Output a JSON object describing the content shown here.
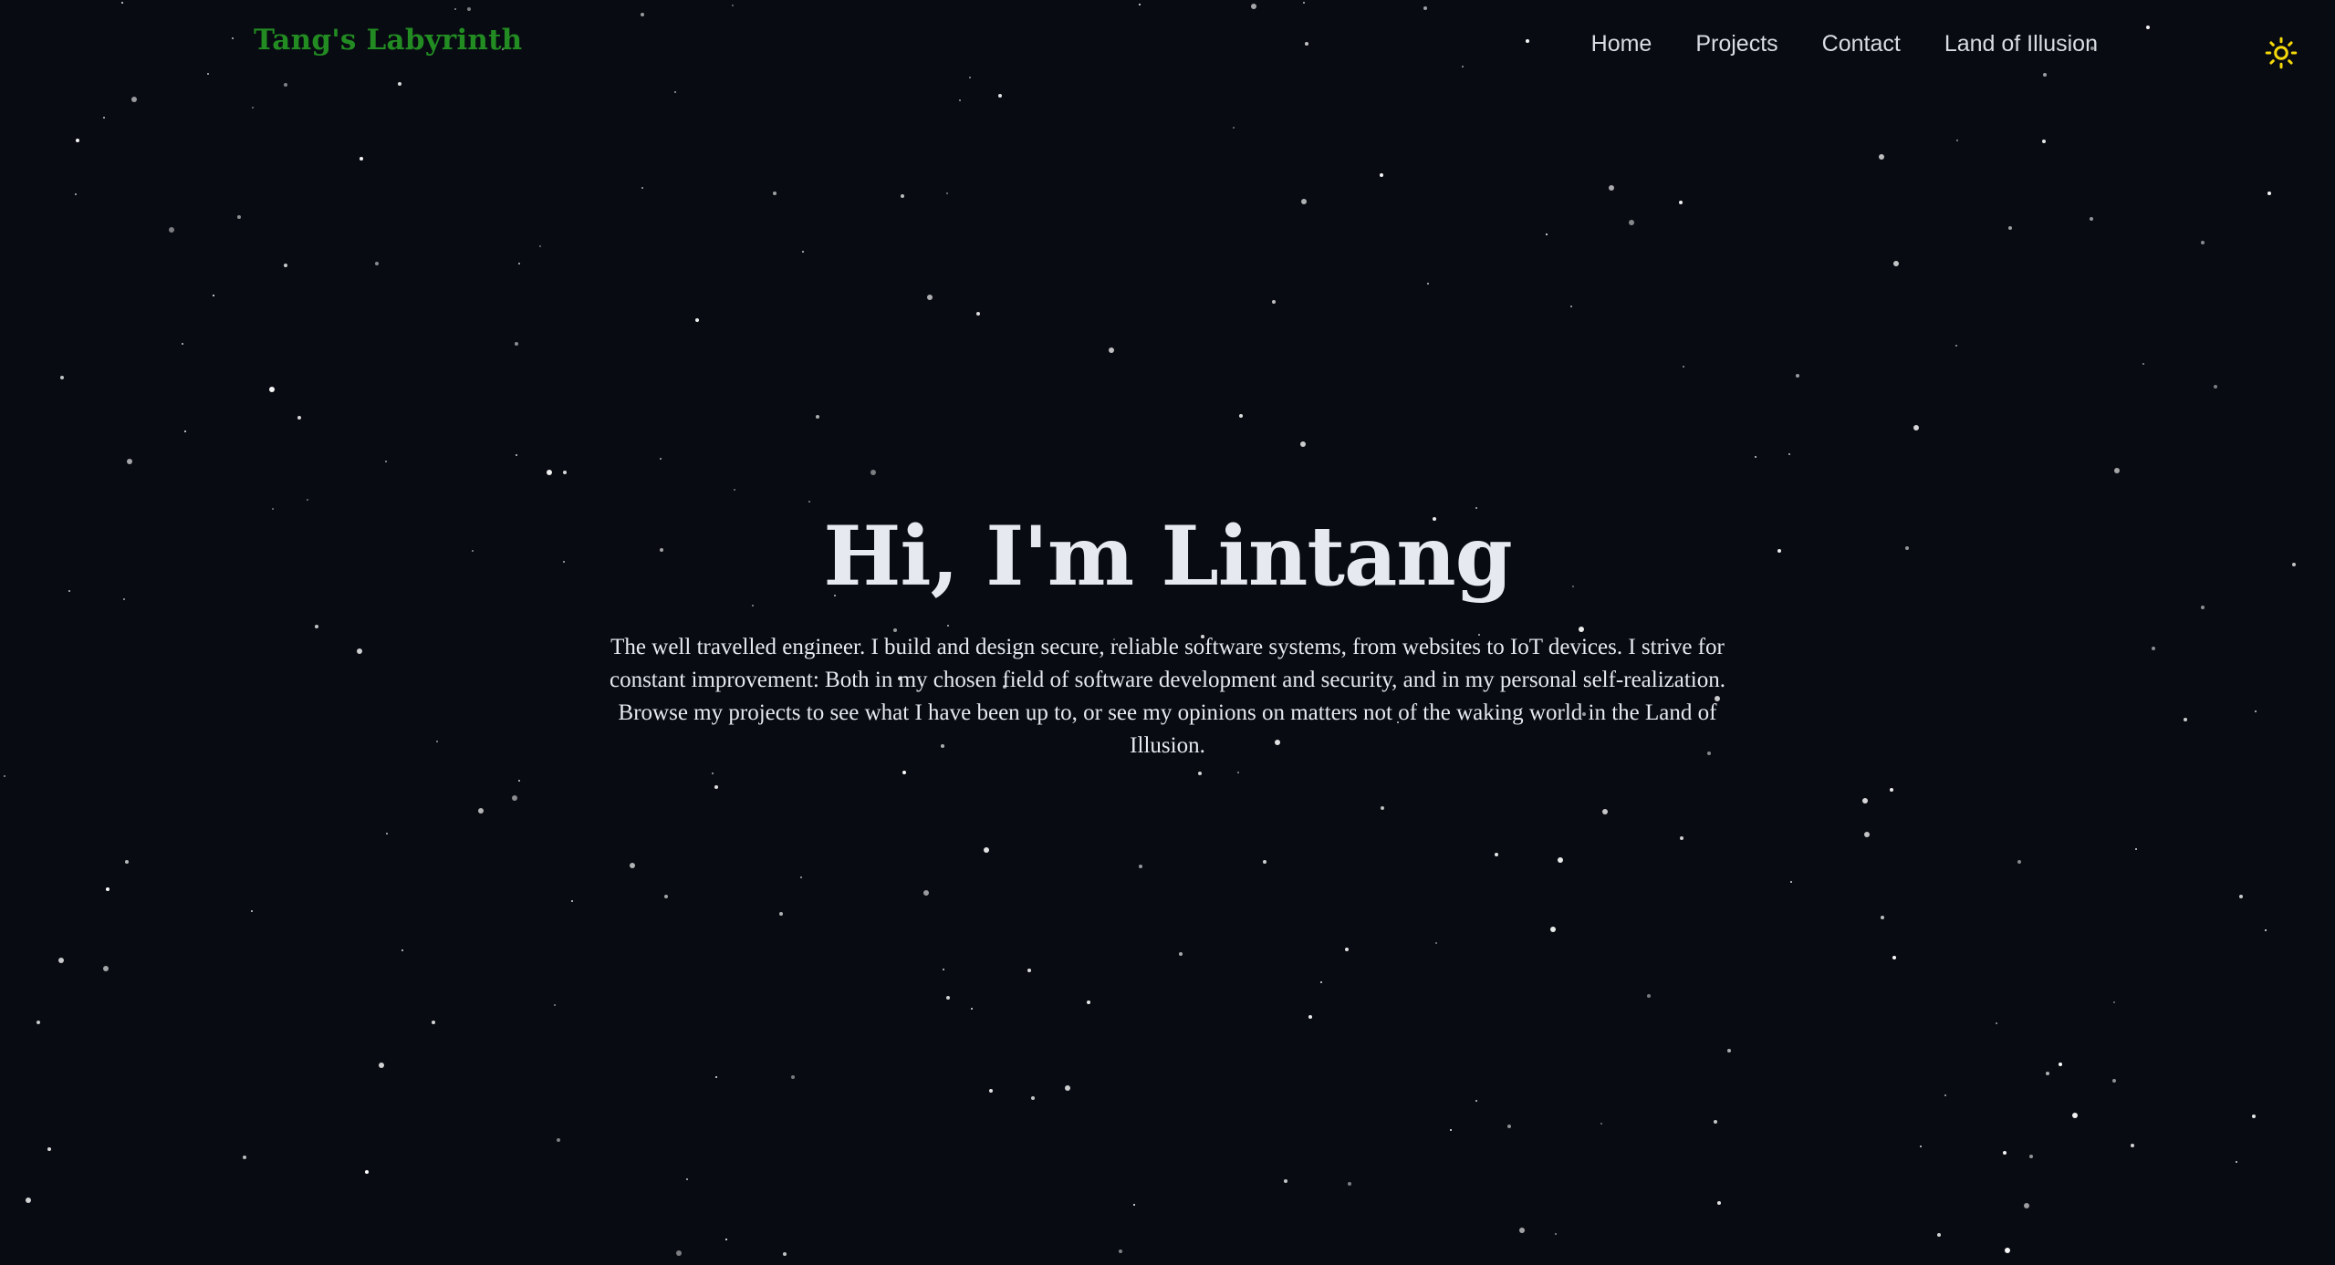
{
  "header": {
    "brand": "Tang's Labyrinth",
    "brand_color": "#228b22",
    "nav": [
      {
        "label": "Home"
      },
      {
        "label": "Projects"
      },
      {
        "label": "Contact"
      },
      {
        "label": "Land of Illusion"
      }
    ],
    "theme_toggle_icon": "sun-icon",
    "theme_toggle_color": "#f5d90a"
  },
  "hero": {
    "title": "Hi, I'm Lintang",
    "description": "The well travelled engineer. I build and design secure, reliable software systems, from websites to IoT devices. I strive for constant improvement: Both in my chosen field of software development and security, and in my personal self-realization. Browse my projects to see what I have been up to, or see my opinions on matters not of the waking world in the Land of Illusion."
  },
  "theme": {
    "background": "#080b12",
    "text": "#e6e9f0",
    "star_color": "#ffffff"
  }
}
